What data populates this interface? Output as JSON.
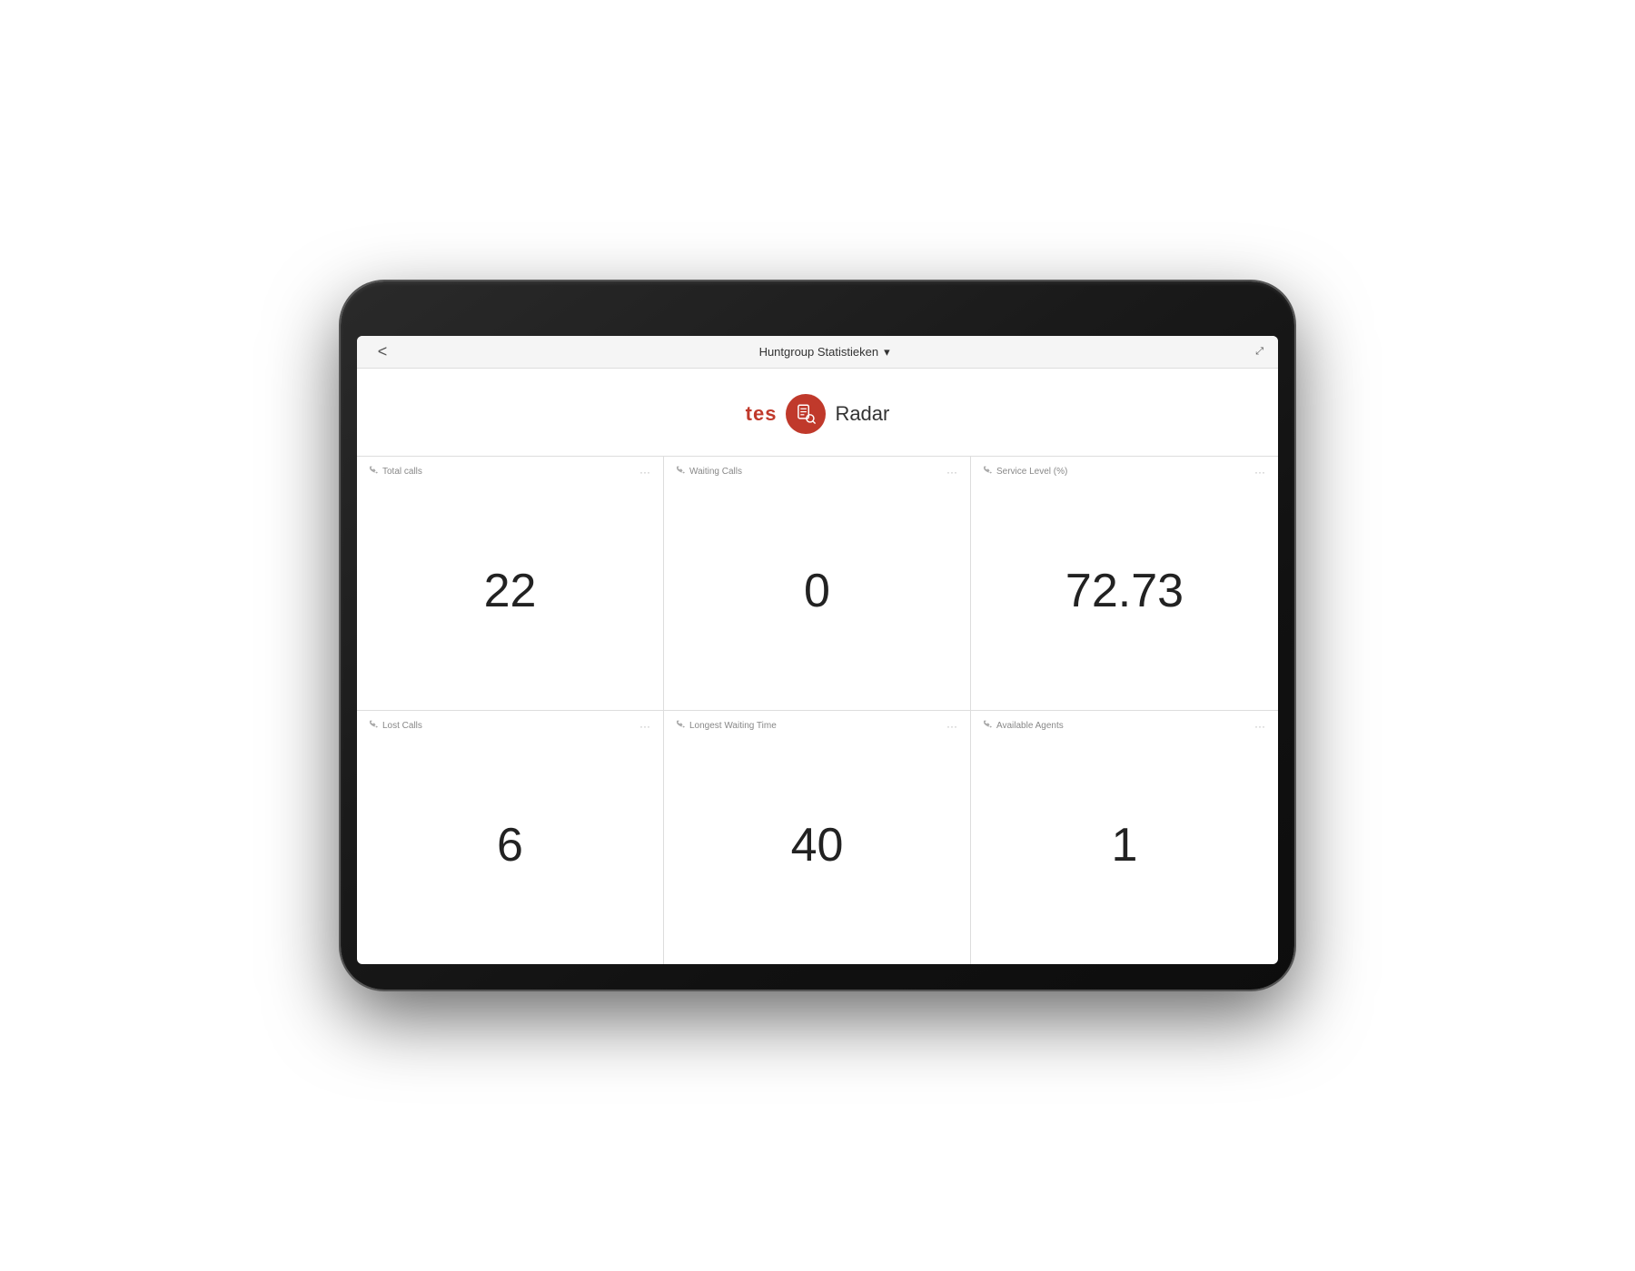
{
  "scene": {
    "background": "white"
  },
  "nav": {
    "back_label": "<",
    "title": "Huntgroup Statistieken",
    "dropdown_icon": "▾",
    "expand_icon": "⤢"
  },
  "logo": {
    "tes_text": "tes",
    "radar_text": "Radar"
  },
  "stats": [
    {
      "id": "total-calls",
      "label": "Total calls",
      "value": "22",
      "icon": "📞"
    },
    {
      "id": "waiting-calls",
      "label": "Waiting Calls",
      "value": "0",
      "icon": "📞"
    },
    {
      "id": "service-level",
      "label": "Service Level (%)",
      "value": "72.73",
      "icon": "📞"
    },
    {
      "id": "lost-calls",
      "label": "Lost Calls",
      "value": "6",
      "icon": "📞"
    },
    {
      "id": "longest-waiting-time",
      "label": "Longest Waiting Time",
      "value": "40",
      "icon": "📞"
    },
    {
      "id": "available-agents",
      "label": "Available Agents",
      "value": "1",
      "icon": "📞"
    }
  ]
}
